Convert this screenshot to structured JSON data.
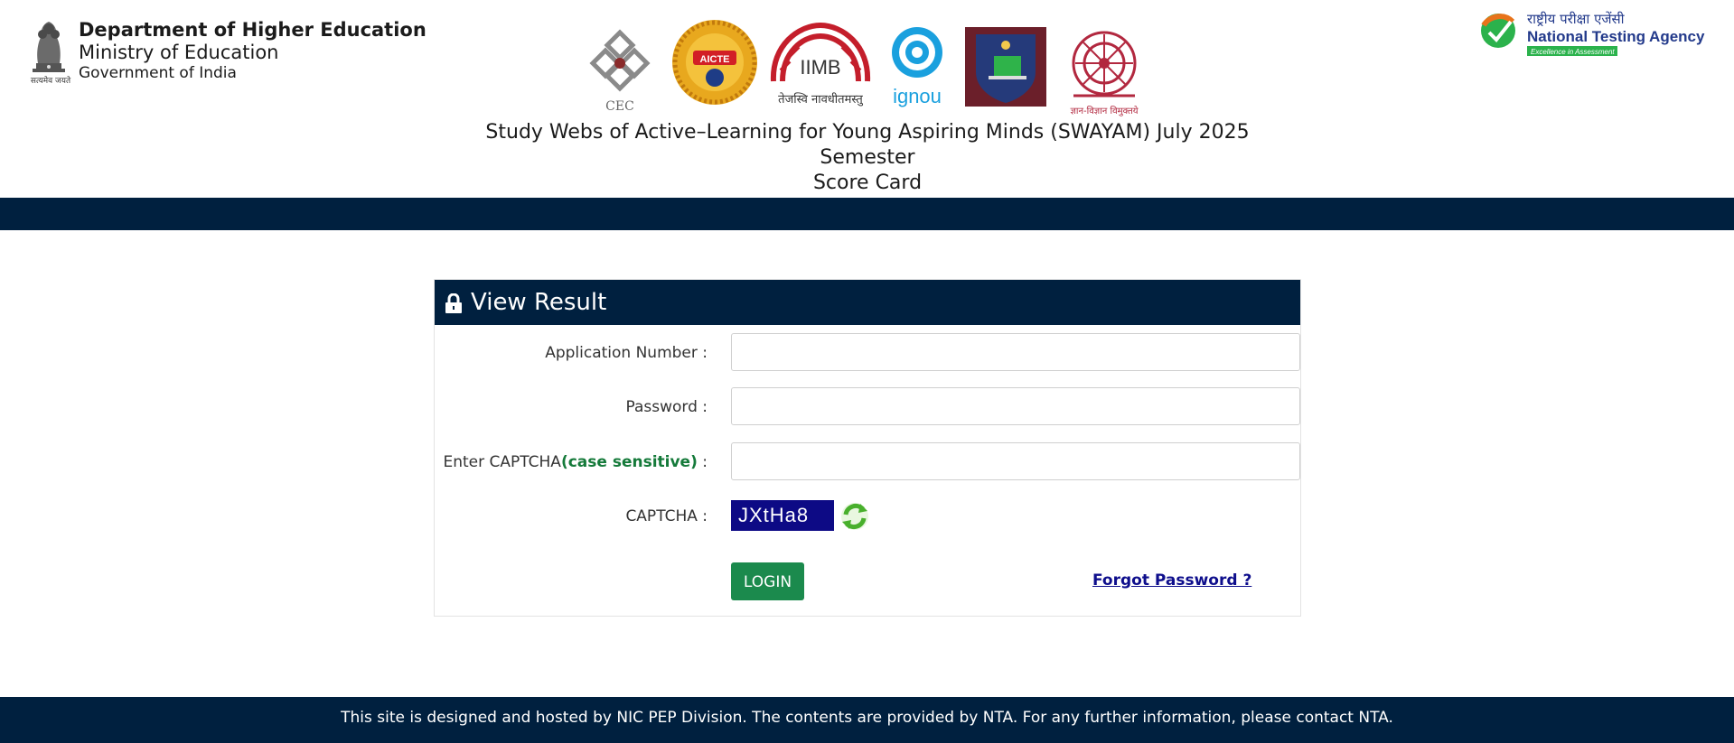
{
  "header": {
    "emblem_motto": "सत्यमेव जयते",
    "department": "Department of Higher Education",
    "ministry": "Ministry of Education",
    "government": "Government of India",
    "logos": {
      "cec": "CEC",
      "aicte": "AICTE",
      "iimb": "IIMB",
      "iimb_motto": "तेजस्वि नावधीतमस्तु",
      "ignou": "ignou",
      "ugc_motto": "ज्ञान-विज्ञान विमुक्तये"
    },
    "nta": {
      "hindi": "राष्ट्रीय परीक्षा एजेंसी",
      "name": "National Testing Agency",
      "tagline": "Excellence in Assessment"
    },
    "title_lines": [
      "Study Webs of Active–Learning for Young Aspiring Minds (SWAYAM) July 2025",
      "Semester",
      "Score Card"
    ]
  },
  "panel": {
    "title": "View Result",
    "application_number_label": "Application Number :",
    "password_label": "Password :",
    "captcha_entry_label": "Enter CAPTCHA",
    "captcha_case_note": "(case sensitive)",
    "captcha_entry_suffix": " :",
    "captcha_label": "CAPTCHA :",
    "captcha_value": "JXtHa8",
    "application_number_value": "",
    "password_value": "",
    "captcha_input_value": "",
    "login_label": "LOGIN",
    "forgot_password_label": "Forgot Password ?"
  },
  "footer": {
    "text": "This site is designed and hosted by NIC PEP Division. The contents are provided by NTA. For any further information, please contact NTA."
  },
  "colors": {
    "navy": "#00203f",
    "login_green": "#1b8a4d",
    "captcha_bg": "#0d0a85",
    "case_note_green": "#157a3a",
    "link_blue": "#0e0e8c"
  }
}
